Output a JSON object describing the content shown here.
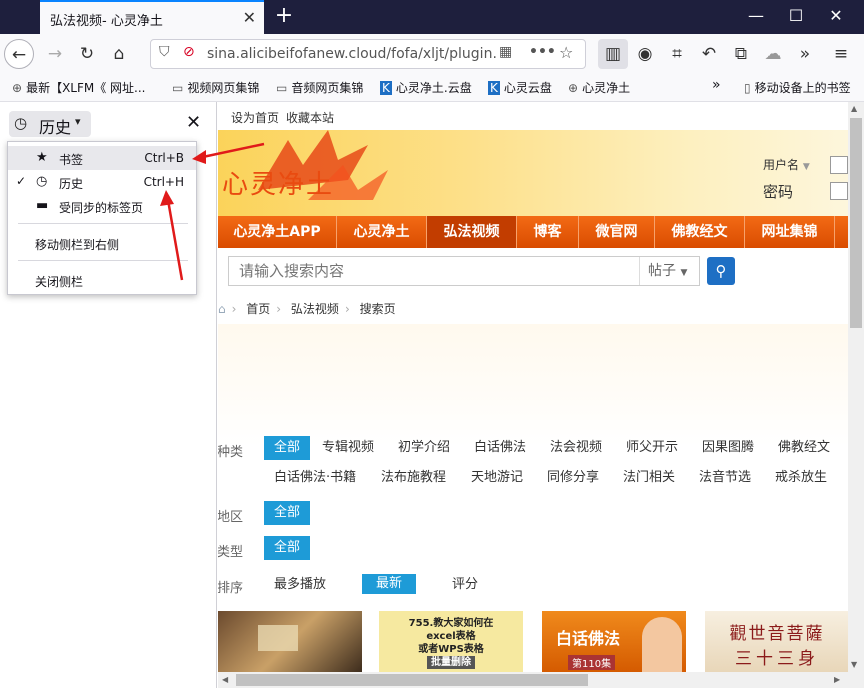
{
  "browser": {
    "tab_title": "弘法视频- 心灵净土",
    "tab_close": "✕",
    "new_tab": "+",
    "win_min": "—",
    "win_max": "☐",
    "win_close": "✕",
    "url": "sina.alicibeifofanew.cloud/fofa/xljt/plugin.p"
  },
  "bookmarks": [
    {
      "label": "最新【XLFM《 网址..."
    },
    {
      "label": "视频网页集锦"
    },
    {
      "label": "音频网页集锦"
    },
    {
      "label": "心灵净土.云盘"
    },
    {
      "label": "心灵云盘"
    },
    {
      "label": "心灵净土"
    },
    {
      "label": "移动设备上的书签"
    }
  ],
  "sidebar": {
    "title": "历史",
    "close": "✕",
    "menu": {
      "bookmarks": {
        "label": "书签",
        "shortcut": "Ctrl+B"
      },
      "history": {
        "label": "历史",
        "shortcut": "Ctrl+H",
        "check": "✓"
      },
      "synced": {
        "label": "受同步的标签页"
      },
      "move": {
        "label": "移动侧栏到右侧"
      },
      "close": {
        "label": "关闭侧栏"
      }
    }
  },
  "page": {
    "top_links": [
      "设为首页",
      "收藏本站"
    ],
    "logo": "心灵净土",
    "login": {
      "user": "用户名",
      "password": "密码"
    },
    "nav": [
      "心灵净土APP",
      "心灵净土",
      "弘法视频",
      "博客",
      "微官网",
      "佛教经文",
      "网址集锦"
    ],
    "search_placeholder": "请输入搜索内容",
    "search_type": "帖子",
    "breadcrumb": [
      "首页",
      "弘法视频",
      "搜索页"
    ],
    "filters": {
      "category_label": "种类",
      "category_row1": [
        "全部",
        "专辑视频",
        "初学介绍",
        "白话佛法",
        "法会视频",
        "师父开示",
        "因果图腾",
        "佛教经文"
      ],
      "category_row2": [
        "白话佛法·书籍",
        "法布施教程",
        "天地游记",
        "同修分享",
        "法门相关",
        "法音节选",
        "戒杀放生"
      ],
      "region_label": "地区",
      "region_opt": "全部",
      "type_label": "类型",
      "type_opt": "全部",
      "sort_label": "排序",
      "sort_opts": [
        "最多播放",
        "最新",
        "评分"
      ]
    },
    "thumbs": {
      "t2_line1": "755.教大家如何在",
      "t2_line2": "excel表格",
      "t2_line3": "或者WPS表格",
      "t2_line4": "批量删除",
      "t3_title": "白话佛法",
      "t3_ep": "第110集",
      "t4_line1": "觀世音菩薩",
      "t4_line2": "三十三身"
    }
  }
}
